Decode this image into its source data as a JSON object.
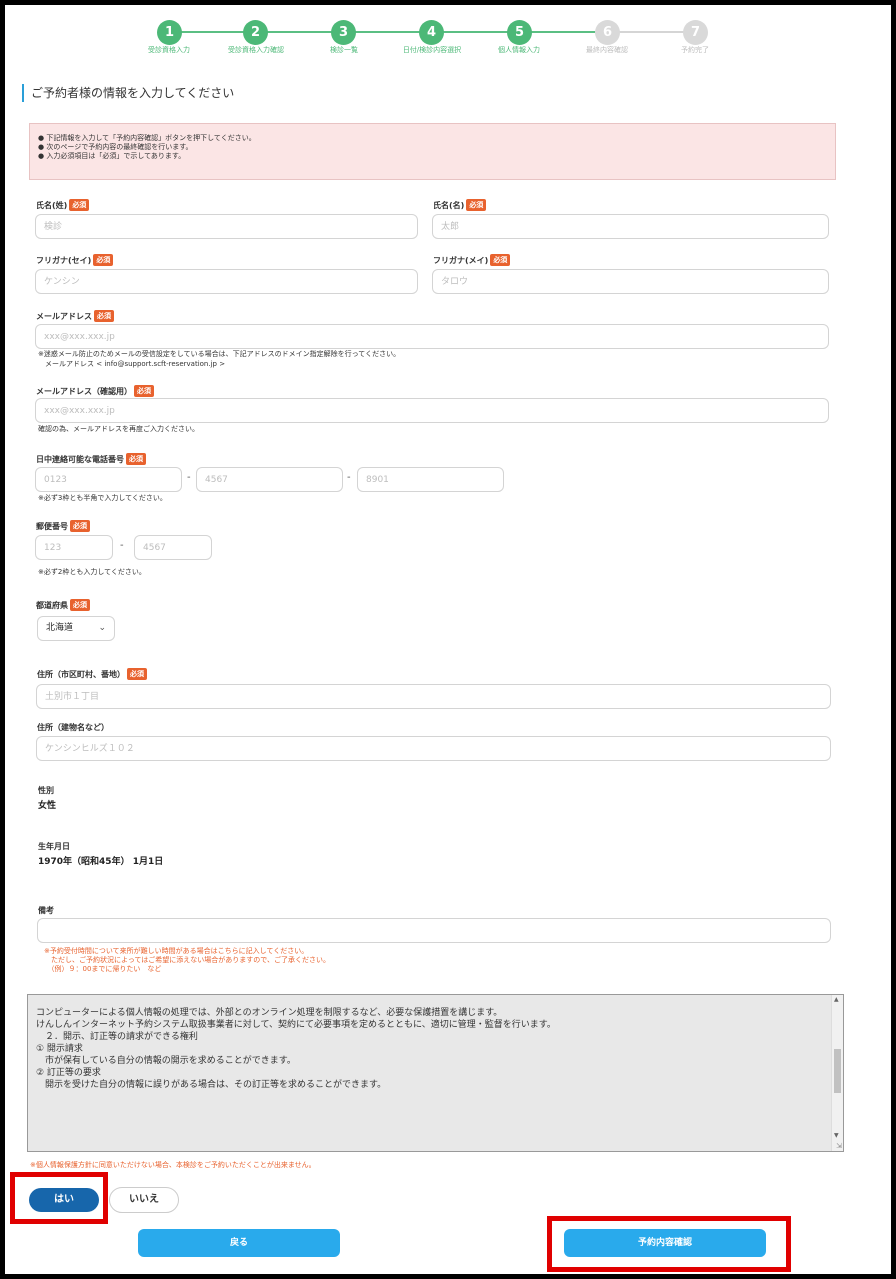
{
  "steps": [
    {
      "num": "1",
      "label": "受診資格入力"
    },
    {
      "num": "2",
      "label": "受診資格入力確認"
    },
    {
      "num": "3",
      "label": "検診一覧"
    },
    {
      "num": "4",
      "label": "日付/検診内容選択"
    },
    {
      "num": "5",
      "label": "個人情報入力"
    },
    {
      "num": "6",
      "label": "最終内容確認"
    },
    {
      "num": "7",
      "label": "予約完了"
    }
  ],
  "section_title": "ご予約者様の情報を入力してください",
  "notice": [
    "● 下記情報を入力して「予約内容確認」ボタンを押下してください。",
    "● 次のページで予約内容の最終確認を行います。",
    "● 入力必須項目は「必須」で示してあります。"
  ],
  "required_badge": "必須",
  "form": {
    "last_name": {
      "label": "氏名(姓)",
      "placeholder": "検診"
    },
    "first_name": {
      "label": "氏名(名)",
      "placeholder": "太郎"
    },
    "last_kana": {
      "label": "フリガナ(セイ)",
      "placeholder": "ケンシン"
    },
    "first_kana": {
      "label": "フリガナ(メイ)",
      "placeholder": "タロウ"
    },
    "email": {
      "label": "メールアドレス",
      "placeholder": "xxx@xxx.xxx.jp",
      "note": "※迷惑メール防止のためメールの受信設定をしている場合は、下記アドレスのドメイン指定解除を行ってください。\n　メールアドレス < info@support.scft-reservation.jp >"
    },
    "email_confirm": {
      "label": "メールアドレス（確認用）",
      "placeholder": "xxx@xxx.xxx.jp",
      "note": "確認の為、メールアドレスを再度ご入力ください。"
    },
    "phone": {
      "label": "日中連絡可能な電話番号",
      "placeholders": [
        "0123",
        "4567",
        "8901"
      ],
      "separator": "-",
      "note": "※必ず3枠とも半角で入力してください。"
    },
    "postal": {
      "label": "郵便番号",
      "placeholders": [
        "123",
        "4567"
      ],
      "separator": "-",
      "note": "※必ず2枠とも入力してください。"
    },
    "prefecture": {
      "label": "都道府県",
      "value": "北海道"
    },
    "address1": {
      "label": "住所（市区町村、番地）",
      "placeholder": "土別市１丁目"
    },
    "address2": {
      "label": "住所（建物名など）",
      "placeholder": "ケンシンヒルズ１０２"
    },
    "gender": {
      "label": "性別",
      "value": "女性"
    },
    "birthdate": {
      "label": "生年月日",
      "value": "1970年（昭和45年） 1月1日"
    },
    "remarks": {
      "label": "備考",
      "placeholder": "",
      "note": "※予約受付時間について来所が難しい時間がある場合はこちらに記入してください。\n　ただし、ご予約状況によってはご希望に添えない場合がありますので、ご了承ください。\n　（例）９：00までに帰りたい　など"
    }
  },
  "policy_text": [
    "コンピューターによる個人情報の処理では、外部とのオンライン処理を制限するなど、必要な保護措置を講じます。",
    "",
    "けんしんインターネット予約システム取扱事業者に対して、契約にて必要事項を定めるとともに、適切に管理・監督を行います。",
    "",
    "　２．開示、訂正等の請求ができる権利",
    "① 開示請求",
    "　市が保有している自分の情報の開示を求めることができます。",
    "",
    "② 訂正等の要求",
    "　開示を受けた自分の情報に誤りがある場合は、その訂正等を求めることができます。"
  ],
  "agree_note": "※個人情報保護方針に同意いただけない場合、本検診をご予約いただくことが出来ません。",
  "buttons": {
    "yes": "はい",
    "no": "いいえ",
    "back": "戻る",
    "confirm": "予約内容確認"
  }
}
